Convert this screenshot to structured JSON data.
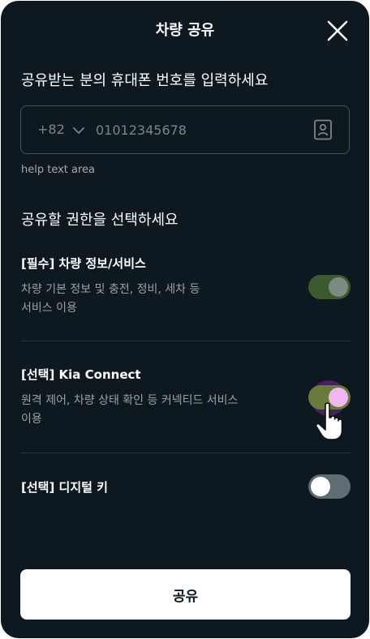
{
  "header": {
    "title": "차량 공유",
    "close_icon": "close-icon"
  },
  "phone_section": {
    "heading": "공유받는 분의 휴대폰 번호를 입력하세요",
    "country_code": "+82",
    "phone_placeholder": "01012345678",
    "phone_value": "",
    "contact_icon": "contact-book-icon",
    "help_text": "help text area"
  },
  "permissions": {
    "heading": "공유할 권한을 선택하세요",
    "items": [
      {
        "title": "[필수] 차량 정보/서비스",
        "desc_line1": "차량 기본 정보 및 충전, 정비, 세차 등",
        "desc_line2": "서비스 이용",
        "enabled": true
      },
      {
        "title": "[선택] Kia Connect",
        "desc_line1": "원격 제어, 차량 상태 확인 등 커넥티드 서비스",
        "desc_line2": "이용",
        "enabled": true
      },
      {
        "title": "[선택] 디지털 키",
        "enabled": false
      }
    ]
  },
  "footer": {
    "share_label": "공유"
  },
  "colors": {
    "background": "#0d1820",
    "toggle_on_required": "#3d5a2e",
    "toggle_on_optional": "#6a7a3a",
    "toggle_off": "#5e6c73"
  }
}
